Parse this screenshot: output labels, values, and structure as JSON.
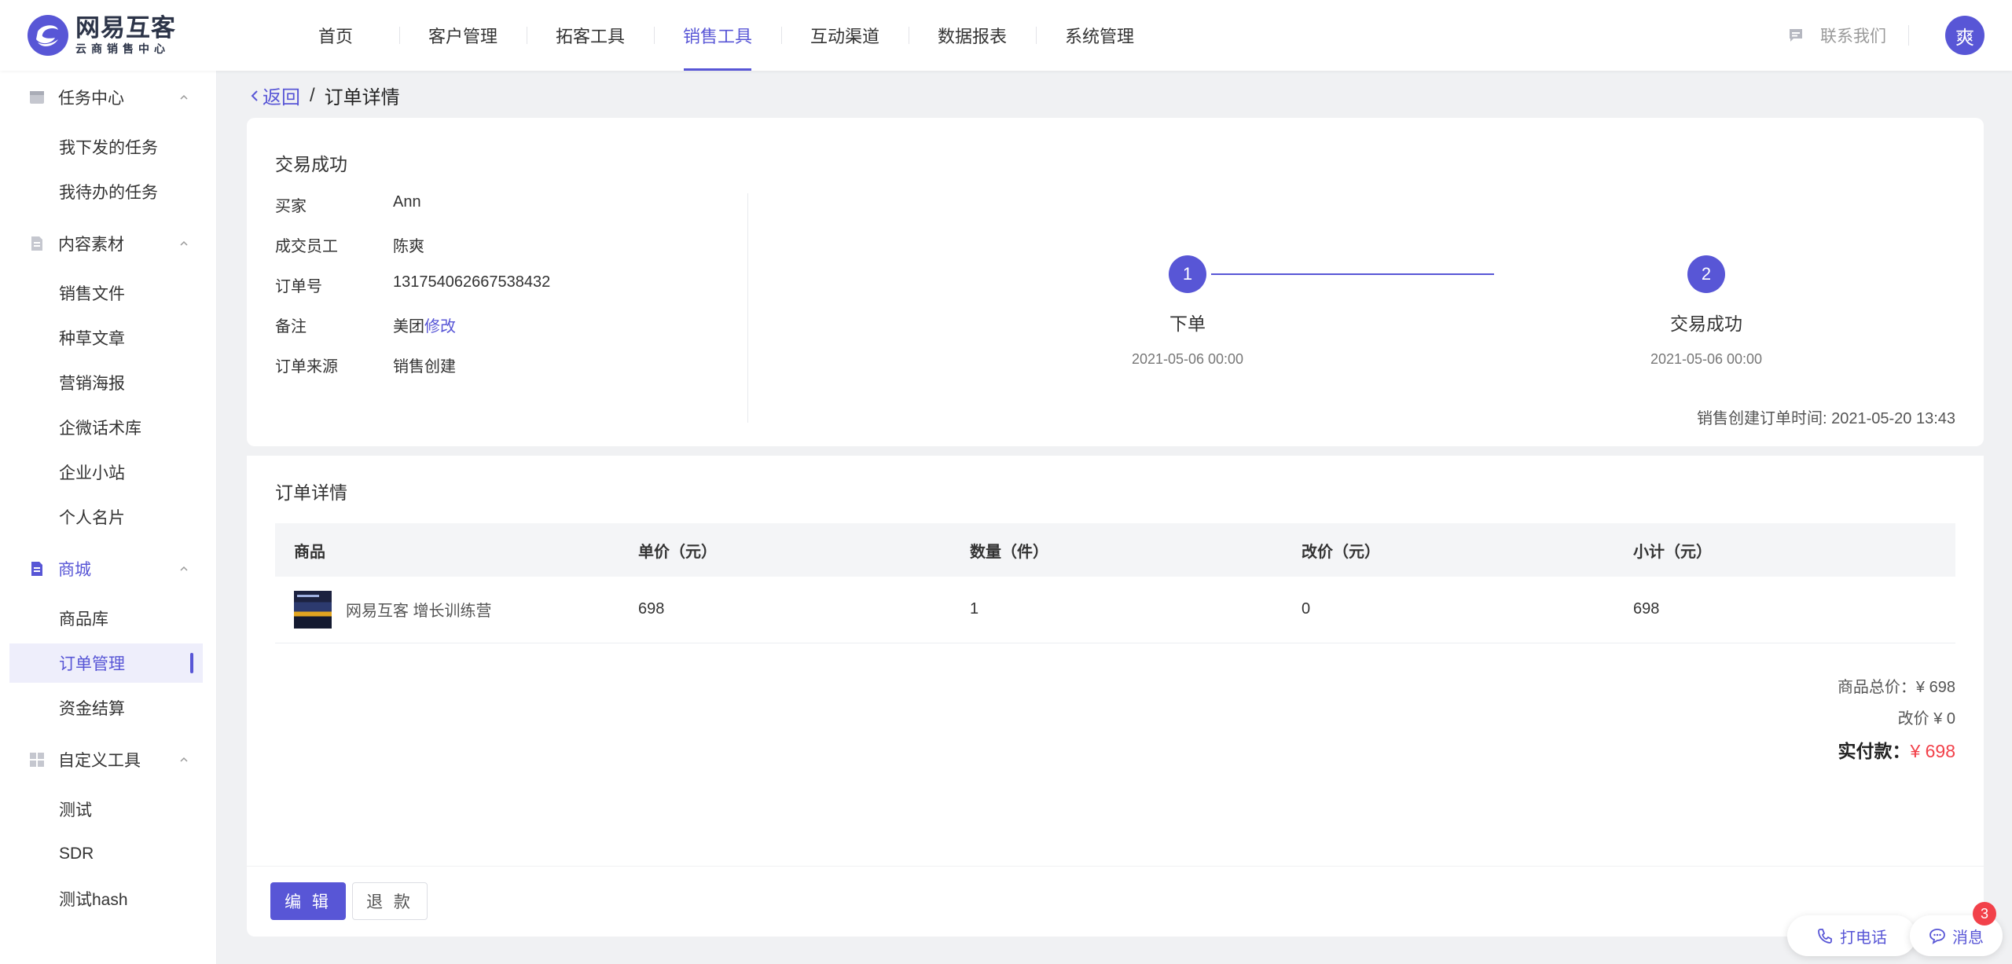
{
  "app": {
    "logo_name": "网易互客",
    "logo_sub": "云商销售中心",
    "brand_color": "#5856d6",
    "icon": "netease-huke-logo"
  },
  "nav": {
    "items": [
      {
        "label": "首页"
      },
      {
        "label": "客户管理"
      },
      {
        "label": "拓客工具"
      },
      {
        "label": "销售工具",
        "active": true
      },
      {
        "label": "互动渠道"
      },
      {
        "label": "数据报表"
      },
      {
        "label": "系统管理"
      }
    ],
    "contact_label": "联系我们",
    "contact_icon": "chat-bubble-icon",
    "avatar_text": "爽"
  },
  "sidebar": {
    "groups": [
      {
        "label": "任务中心",
        "icon": "task-icon",
        "items": [
          "我下发的任务",
          "我待办的任务"
        ]
      },
      {
        "label": "内容素材",
        "icon": "document-icon",
        "items": [
          "销售文件",
          "种草文章",
          "营销海报",
          "企微话术库",
          "企业小站",
          "个人名片"
        ]
      },
      {
        "label": "商城",
        "icon": "mall-icon",
        "active": true,
        "items": [
          "商品库",
          "订单管理",
          "资金结算"
        ],
        "active_item": "订单管理"
      },
      {
        "label": "自定义工具",
        "icon": "grid-icon",
        "items": [
          "测试",
          "SDR",
          "测试hash"
        ]
      }
    ]
  },
  "breadcrumb": {
    "back_label": "返回",
    "separator": "/",
    "current": "订单详情"
  },
  "order_status": {
    "title": "交易成功",
    "fields": [
      {
        "key": "买家",
        "value": "Ann",
        "is_link": true
      },
      {
        "key": "成交员工",
        "value": "陈爽"
      },
      {
        "key": "订单号",
        "value": "131754062667538432"
      },
      {
        "key": "备注",
        "value": "美团",
        "action": "修改"
      },
      {
        "key": "订单来源",
        "value": "销售创建"
      }
    ],
    "steps": [
      {
        "num": "1",
        "label": "下单",
        "time": "2021-05-06 00:00"
      },
      {
        "num": "2",
        "label": "交易成功",
        "time": "2021-05-06 00:00"
      }
    ],
    "created_text": "销售创建订单时间: 2021-05-20 13:43"
  },
  "order_detail": {
    "title": "订单详情",
    "columns": [
      "商品",
      "单价（元）",
      "数量（件）",
      "改价（元）",
      "小计（元）"
    ],
    "rows": [
      {
        "product": "网易互客 增长训练营",
        "price": "698",
        "qty": "1",
        "adjust": "0",
        "subtotal": "698"
      }
    ],
    "total_label": "商品总价：¥ 698",
    "adjust_label": "改价 ¥ 0",
    "paid_label": "实付款：",
    "paid_amount": "¥ 698",
    "paid_color": "#f2414a"
  },
  "actions": {
    "edit": "编 辑",
    "refund": "退 款"
  },
  "floating": {
    "call_label": "打电话",
    "msg_label": "消息",
    "msg_badge": "3"
  }
}
